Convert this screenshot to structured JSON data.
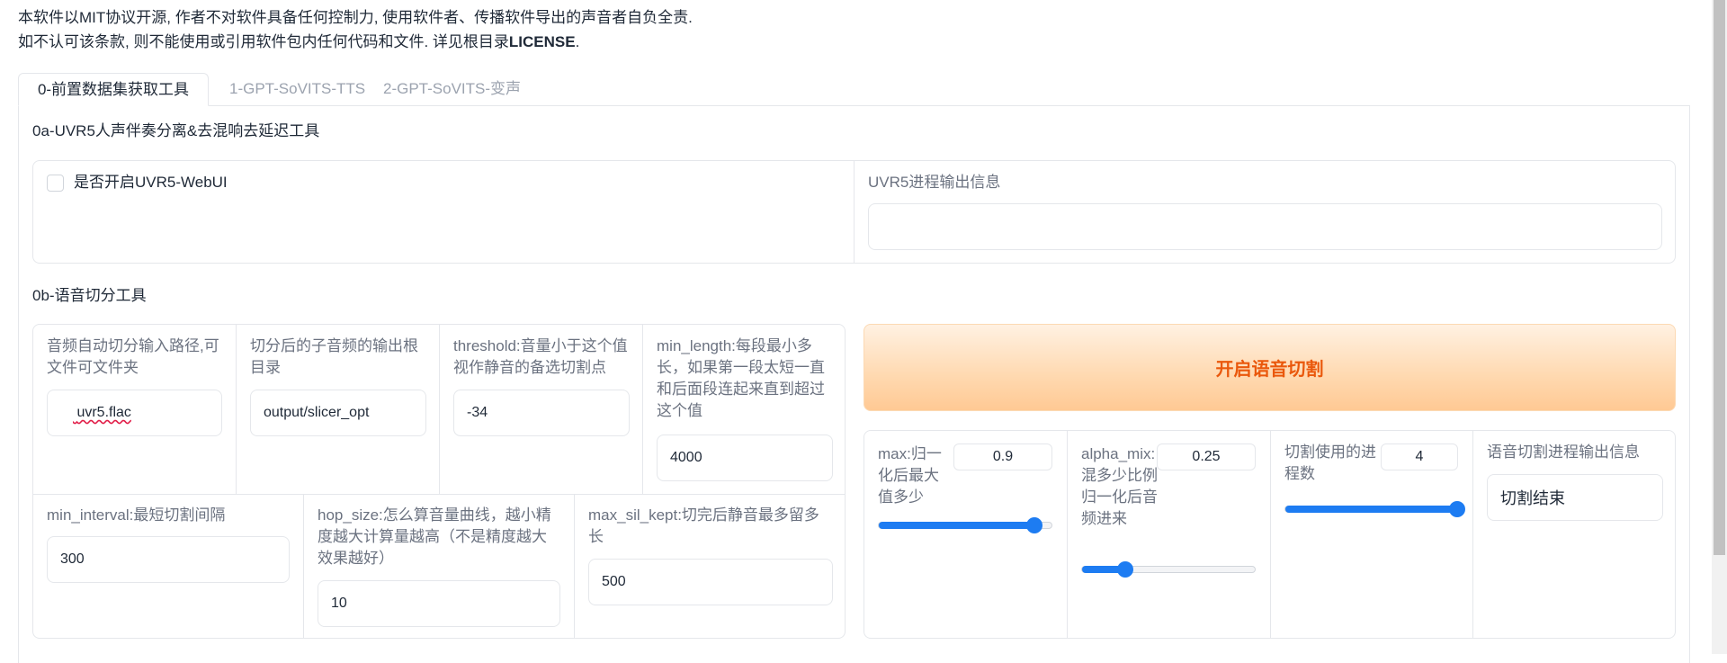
{
  "notice": {
    "line1": "本软件以MIT协议开源, 作者不对软件具备任何控制力, 使用软件者、传播软件导出的声音者自负全责.",
    "line2_prefix": "如不认可该条款, 则不能使用或引用软件包内任何代码和文件. 详见根目录",
    "line2_license": "LICENSE",
    "line2_suffix": "."
  },
  "tabs": [
    {
      "label": "0-前置数据集获取工具",
      "active": true
    },
    {
      "label": "1-GPT-SoVITS-TTS",
      "active": false
    },
    {
      "label": "2-GPT-SoVITS-变声",
      "active": false
    }
  ],
  "uvr5": {
    "title": "0a-UVR5人声伴奏分离&去混响去延迟工具",
    "checkbox_label": "是否开启UVR5-WebUI",
    "checkbox_checked": false,
    "output_label": "UVR5进程输出信息",
    "output_value": ""
  },
  "slicer": {
    "title": "0b-语音切分工具",
    "input_path": {
      "label": "音频自动切分输入路径,可文件可文件夹",
      "value_prefix": "",
      "value_word": "uvr5.flac"
    },
    "output_dir": {
      "label": "切分后的子音频的输出根目录",
      "value": "output/slicer_opt"
    },
    "threshold": {
      "label": "threshold:音量小于这个值视作静音的备选切割点",
      "value": "-34"
    },
    "min_length": {
      "label": "min_length:每段最小多长，如果第一段太短一直和后面段连起来直到超过这个值",
      "value": "4000"
    },
    "min_interval": {
      "label": "min_interval:最短切割间隔",
      "value": "300"
    },
    "hop_size": {
      "label": "hop_size:怎么算音量曲线，越小精度越大计算量越高（不是精度越大效果越好）",
      "value": "10"
    },
    "max_sil_kept": {
      "label": "max_sil_kept:切完后静音最多留多长",
      "value": "500"
    },
    "start_button": "开启语音切割",
    "max": {
      "label": "max:归一化后最大值多少",
      "value": "0.9",
      "min": 0,
      "maxv": 1,
      "level": 0.9
    },
    "alpha_mix": {
      "label": "alpha_mix:混多少比例归一化后音频进来",
      "value": "0.25",
      "min": 0,
      "maxv": 1,
      "level": 0.25
    },
    "n_process": {
      "label": "切割使用的进程数",
      "value": "4",
      "min": 1,
      "maxv": 4,
      "level": 4
    },
    "output_label": "语音切割进程输出信息",
    "output_value": "切割结束"
  },
  "colors": {
    "accent": "#1d7cf2",
    "button_text": "#ea580c"
  }
}
